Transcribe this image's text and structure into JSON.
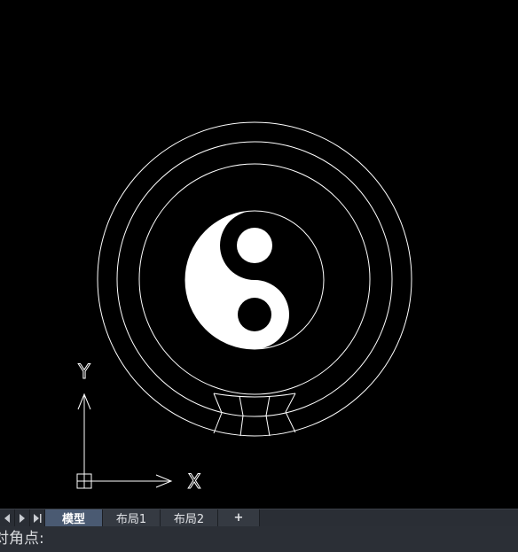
{
  "canvas": {
    "background_color": "#000000",
    "line_color": "#ffffff",
    "ucs_icon": {
      "y_label": "Y",
      "x_label": "X"
    }
  },
  "tabs": {
    "items": [
      {
        "label": "模型",
        "active": true
      },
      {
        "label": "布局1",
        "active": false
      },
      {
        "label": "布局2",
        "active": false
      }
    ],
    "add_label": "+"
  },
  "command_line": {
    "prompt": "对角点:"
  },
  "colors": {
    "tab_bar_bg": "#2a2e35",
    "active_tab_bg": "#4a5a72",
    "command_bg": "#2b2f36"
  }
}
